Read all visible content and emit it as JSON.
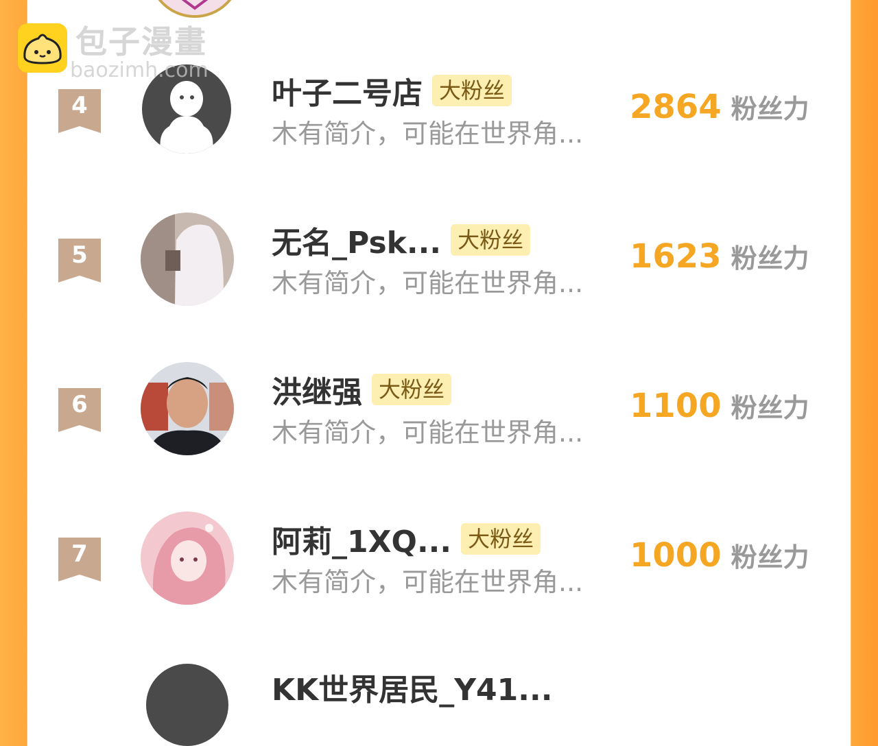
{
  "watermark": {
    "title": "包子漫畫",
    "url": "baozimh.com"
  },
  "colors": {
    "accent": "#f5a623",
    "tag_bg": "#fdefb2",
    "side_orange": "#ffa73a",
    "rank_badge": "#c9a890"
  },
  "fan_label": "大粉丝",
  "score_unit": "粉丝力",
  "rows": [
    {
      "rank": "4",
      "name": "叶子二号店",
      "intro": "木有简介，可能在世界角...",
      "score": "2864",
      "avatar": "default-person-icon"
    },
    {
      "rank": "5",
      "name": "无名_Psk...",
      "intro": "木有简介，可能在世界角...",
      "score": "1623",
      "avatar": "photo-avatar"
    },
    {
      "rank": "6",
      "name": "洪继强",
      "intro": "木有简介，可能在世界角...",
      "score": "1100",
      "avatar": "photo-avatar"
    },
    {
      "rank": "7",
      "name": "阿莉_1XQ...",
      "intro": "木有简介，可能在世界角...",
      "score": "1000",
      "avatar": "illustration-avatar"
    }
  ],
  "next_row": {
    "name": "KK世界居民_Y41..."
  }
}
